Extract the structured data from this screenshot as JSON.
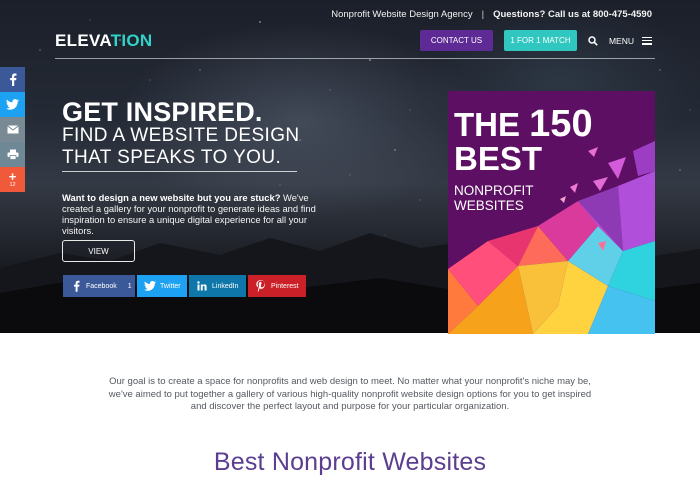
{
  "topbar": {
    "agency": "Nonprofit Website Design Agency",
    "separator": "|",
    "phone": "Questions? Call us at 800-475-4590"
  },
  "logo": {
    "text_main": "ELEVA",
    "text_accent": "TION"
  },
  "nav": {
    "contact_label": "CONTACT US",
    "match_label": "1 FOR 1 MATCH",
    "menu_label": "MENU"
  },
  "side_share": {
    "more_count": "12"
  },
  "hero": {
    "headline": "GET INSPIRED.",
    "subheadline": "FIND A WEBSITE DESIGN THAT SPEAKS TO YOU.",
    "intro_bold": "Want to design a new website but you are stuck?",
    "intro_rest": " We've created a gallery for your nonprofit to generate ideas and find inspiration to ensure a unique digital experience for all your visitors.",
    "view_label": "VIEW"
  },
  "share_buttons": {
    "facebook_label": "Facebook",
    "facebook_count": "1",
    "twitter_label": "Twitter",
    "linkedin_label": "LinkedIn",
    "pinterest_label": "Pinterest"
  },
  "promo": {
    "line1_prefix": "THE ",
    "line1_number": "150",
    "line2": "BEST",
    "sub": "NONPROFIT WEBSITES"
  },
  "about": {
    "text": "Our goal is to create a space for nonprofits and web design to meet. No matter what your nonprofit's niche may be, we've aimed to put together a gallery of various high-quality nonprofit website design options for you to get inspired and discover the perfect layout and purpose for your particular organization."
  },
  "section": {
    "title": "Best Nonprofit Websites"
  },
  "colors": {
    "brand_purple": "#5e2a96",
    "brand_teal": "#2fc7bf",
    "facebook": "#3b5998",
    "twitter": "#1da1f2",
    "linkedin": "#0e76a8",
    "pinterest": "#cb2027",
    "title_purple": "#5b3e8f"
  }
}
